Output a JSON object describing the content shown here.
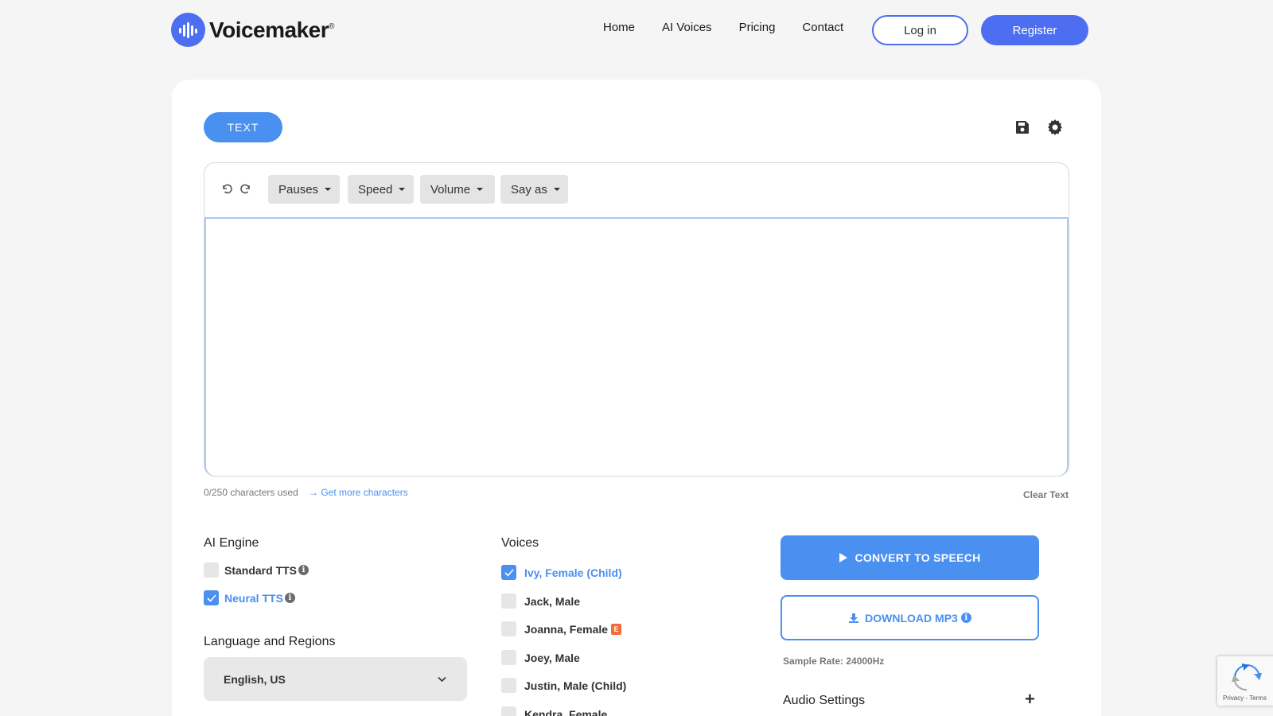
{
  "brand": {
    "name": "Voicemaker",
    "reg": "®"
  },
  "nav": {
    "items": [
      "Home",
      "AI Voices",
      "Pricing",
      "Contact"
    ],
    "login": "Log in",
    "register": "Register"
  },
  "tabs": {
    "text": "TEXT"
  },
  "toolbar": {
    "pauses": "Pauses",
    "speed": "Speed",
    "volume": "Volume",
    "say_as": "Say as"
  },
  "editor": {
    "value": "",
    "char_count": "0/250 characters used",
    "more_chars": "Get more characters",
    "clear": "Clear Text"
  },
  "engine": {
    "title": "AI Engine",
    "options": [
      {
        "label": "Standard TTS",
        "checked": false
      },
      {
        "label": "Neural TTS",
        "checked": true
      }
    ]
  },
  "language": {
    "title": "Language and Regions",
    "selected": "English, US"
  },
  "voices": {
    "title": "Voices",
    "items": [
      {
        "label": "Ivy, Female (Child)",
        "checked": true
      },
      {
        "label": "Jack, Male",
        "checked": false
      },
      {
        "label": "Joanna, Female",
        "checked": false,
        "badge": "E"
      },
      {
        "label": "Joey, Male",
        "checked": false
      },
      {
        "label": "Justin, Male (Child)",
        "checked": false
      },
      {
        "label": "Kendra, Female",
        "checked": false
      }
    ]
  },
  "actions": {
    "convert": "CONVERT TO SPEECH",
    "download": "DOWNLOAD MP3",
    "sample_rate": "Sample Rate: 24000Hz",
    "audio_settings": "Audio Settings",
    "expand": "+"
  },
  "recaptcha": {
    "footer": "Privacy - Terms"
  },
  "colors": {
    "brand": "#4d6ef0",
    "accent": "#4a90f0"
  }
}
